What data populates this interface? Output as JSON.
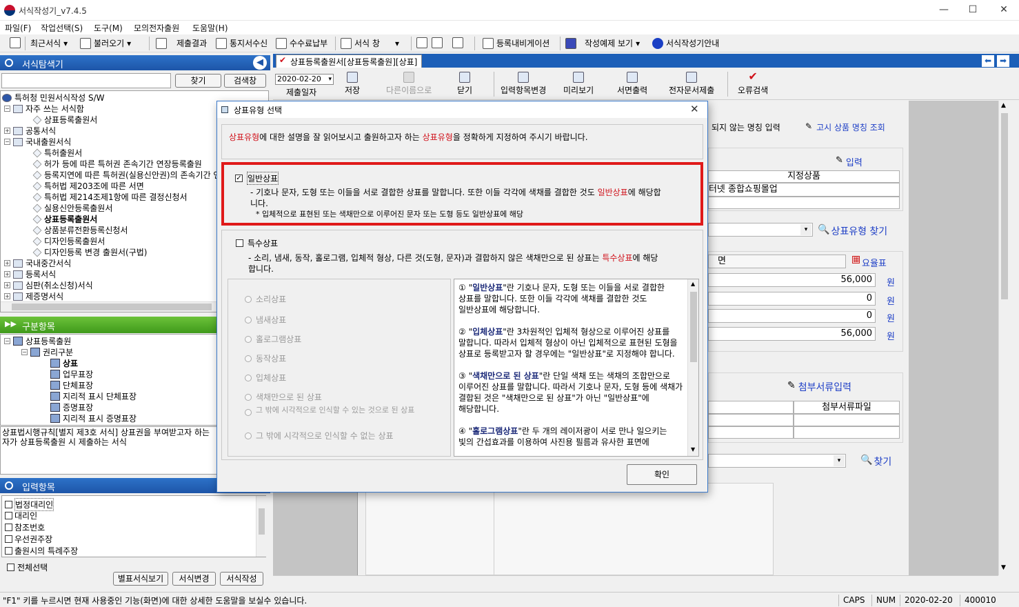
{
  "window": {
    "title": "서식작성기_v7.4.5"
  },
  "menu": [
    "파일(F)",
    "작업선택(S)",
    "도구(M)",
    "모의전자출원",
    "도움말(H)"
  ],
  "toolbar": {
    "recent": "최근서식",
    "open": "불러오기",
    "submit_result": "제출결과",
    "notice_receive": "통지서수신",
    "fee_pay": "수수료납부",
    "form_window": "서식 창",
    "nav": "등록내비게이션",
    "example": "작성예제 보기",
    "guide": "서식작성기안내"
  },
  "explorer": {
    "header": "서식탐색기",
    "find": "찾기",
    "search_window": "검색창",
    "tree": [
      "특허청 민원서식작성 S/W",
      "자주 쓰는 서식함",
      "상표등록출원서",
      "공통서식",
      "국내출원서식",
      "특허출원서",
      "허가 등에 따른 특허권 존속기간 연장등록출원",
      "등록지연에 따른 특허권(실용신안권)의 존속기간 연장등록출원서",
      "특허법 제203조에 따른 서면",
      "특허법 제214조제1항에 따른 결정신청서",
      "실용신안등록출원서",
      "상표등록출원서",
      "상품분류전환등록신청서",
      "디자인등록출원서",
      "디자인등록 변경 출원서(구법)",
      "국내중간서식",
      "등록서식",
      "심판(취소신청)서식",
      "제증명서식"
    ]
  },
  "category": {
    "header": "구분항목",
    "tree": [
      "상표등록출원",
      "권리구분",
      "상표",
      "업무표장",
      "단체표장",
      "지리적 표시 단체표장",
      "증명표장",
      "지리적 표시 증명표장"
    ],
    "desc": "상표법시행규칙[별지 제3호 서식] 상표권을 부여받고자 하는 자가 상표등록출원 시 제출하는 서식"
  },
  "input_items": {
    "header": "입력항목",
    "items": [
      "법정대리인",
      "대리인",
      "참조번호",
      "우선권주장",
      "출원시의 특례주장"
    ],
    "select_all": "전체선택",
    "btn_attach": "별표서식보기",
    "btn_change": "서식변경",
    "btn_write": "서식작성"
  },
  "document": {
    "tab": "상표등록출원서[상표등록출원][상표]",
    "date": "2020-02-20",
    "tools": [
      "제출일자",
      "저장",
      "다른이름으로",
      "닫기",
      "입력항목변경",
      "미리보기",
      "서면출력",
      "전자문서제출",
      "오류검색"
    ],
    "unlisted": "되지 않는 명칭 입력",
    "notice_lookup": "고시 상품 명칭 조회",
    "input": "입력",
    "designated_goods": "지정상품",
    "goods_value": "인터넷 종합쇼핑몰업",
    "find_type": "상표유형 찾기",
    "fee_label": "면",
    "fee_table": "요율표",
    "fees": [
      "56,000",
      "0",
      "0",
      "56,000"
    ],
    "won": "원",
    "attach_input": "첨부서류입력",
    "attach_file": "첨부서류파일",
    "find": "찾기"
  },
  "dialog": {
    "title": "상표유형 선택",
    "intro": {
      "a": "상표유형",
      "b": "에 대한 설명을 잘 읽어보시고 출원하고자 하는 ",
      "c": "상표유형",
      "d": "을 정확하게 지정하여 주시기 바랍니다."
    },
    "general": {
      "label": "일반상표",
      "checked": true,
      "desc_a": "- 기호나 문자, 도형 또는 이들을 서로 결합한 상표를 말합니다. 또한 이들 각각에 색채를 결합한 것도 ",
      "desc_b": "일반상표",
      "desc_c": "에 해당합",
      "desc_d": "니다.",
      "note": "* 입체적으로 표현된 또는 색채만으로 이루어진 문자 또는 도형 등도 일반상표에 해당"
    },
    "special": {
      "label": "특수상표",
      "checked": false,
      "desc_a": "- 소리, 냄새, 동작, 홀로그램, 입체적 형상, 다른 것(도형, 문자)과 결합하지 않은 색채만으로 된 상표는 ",
      "desc_b": "특수상표",
      "desc_c": "에 해당",
      "desc_d": "합니다."
    },
    "options": [
      "소리상표",
      "냄새상표",
      "홀로그램상표",
      "동작상표",
      "입체상표",
      "색채만으로 된 상표",
      "그 밖에 시각적으로 인식할 수 있는 것으로 된 상표",
      "그 밖에 시각적으로 인식할 수 없는 상표"
    ],
    "help": [
      {
        "n": "① \"",
        "k": "일반상표",
        "r": "\"란 기호나 문자, 도형 또는 이들을 서로 결합한 상표를 말합니다. 또한 이들 각각에 색채를 결합한 것도 일반상표에 해당합니다."
      },
      {
        "n": "② \"",
        "k": "입체상표",
        "r": "\"란 3차원적인 입체적 형상으로 이루어진 상표를 말합니다. 따라서 입체적 형상이 아닌 입체적으로 표현된 도형을 상표로 등록받고자 할 경우에는 \"일반상표\"로 지정해야 합니다."
      },
      {
        "n": "③ \"",
        "k": "색채만으로 된 상표",
        "r": "\"란 단일 색채 또는 색채의 조합만으로 이루어진 상표를 말합니다. 따라서 기호나 문자, 도형 등에 색채가 결합된 것은 \"색채만으로 된 상표\"가 아닌 \"일반상표\"에 해당합니다."
      },
      {
        "n": "④ \"",
        "k": "홀로그램상표",
        "r": "\"란 두 개의 레이저광이 서로 만나 일으키는 빛의 간섭효과를 이용하여 사진용 필름과 유사한 표면에"
      }
    ],
    "ok": "확인"
  },
  "status": {
    "help": "\"F1\" 키를 누르시면 현재 사용중인 기능(화면)에 대한 상세한 도움말을 보실수 있습니다.",
    "caps": "CAPS",
    "num": "NUM",
    "date": "2020-02-20",
    "code": "400010"
  }
}
